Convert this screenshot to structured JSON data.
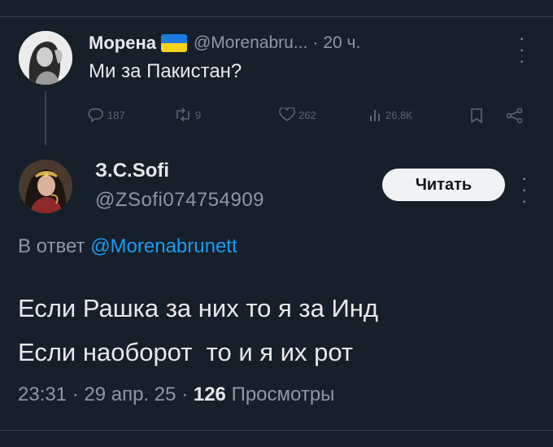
{
  "tweet1": {
    "author_name": "Морена",
    "handle": "@Morenabru...",
    "separator": "·",
    "time": "20 ч.",
    "text": "Ми за Пакистан?",
    "stats": {
      "replies": "187",
      "reposts": "9",
      "likes": "262",
      "views": "26,8К"
    }
  },
  "tweet2": {
    "author_name": "З.С.Sofi",
    "handle": "@ZSofi074754909",
    "follow_label": "Читать",
    "reply_prefix": "В ответ",
    "reply_mention": "@Morenabrunett",
    "text_line1": "Если Рашка за них то я за Инд",
    "text_line2": "Если наоборот  то и я их рот",
    "time": "23:31",
    "date": "29 апр. 25",
    "separator": "·",
    "views_count": "126",
    "views_label": "Просмотры"
  },
  "colors": {
    "background": "#15202b",
    "text": "#e7e9ea",
    "secondary": "#8b98a5",
    "link": "#1d9bf0",
    "flag_blue": "#1e7be0",
    "flag_yellow": "#f5d11a"
  }
}
